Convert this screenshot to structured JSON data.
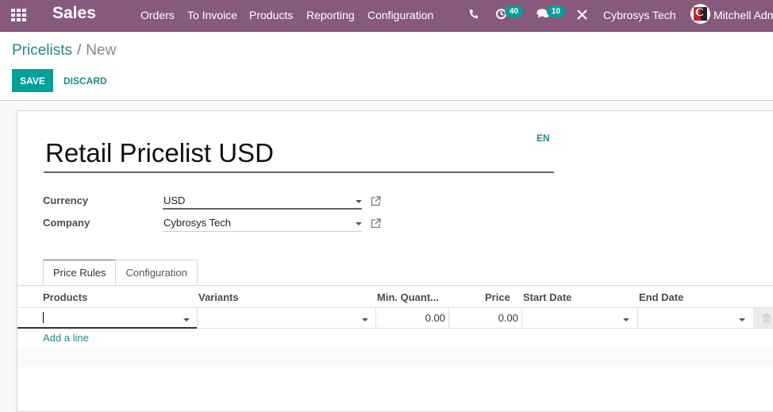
{
  "navbar": {
    "app_title": "Sales",
    "menu": [
      "Orders",
      "To Invoice",
      "Products",
      "Reporting",
      "Configuration"
    ],
    "activity_count": "40",
    "messages_count": "10",
    "company": "Cybrosys Tech",
    "user": "Mitchell Adm",
    "colors": {
      "bar": "#875a7b",
      "badge": "#00a09d"
    }
  },
  "breadcrumb": {
    "parent": "Pricelists",
    "separator": "/",
    "current": "New"
  },
  "buttons": {
    "save": "SAVE",
    "discard": "DISCARD"
  },
  "form": {
    "name": "Retail Pricelist USD",
    "lang": "EN",
    "fields": [
      {
        "label": "Currency",
        "value": "USD"
      },
      {
        "label": "Company",
        "value": "Cybrosys Tech"
      }
    ],
    "tabs": [
      "Price Rules",
      "Configuration"
    ],
    "active_tab": "Price Rules"
  },
  "rules_table": {
    "columns": [
      "Products",
      "Variants",
      "Min. Quant...",
      "Price",
      "Start Date",
      "End Date"
    ],
    "rows": [
      {
        "product": "",
        "variant": "",
        "min_quantity": "0.00",
        "price": "0.00",
        "start_date": "",
        "end_date": ""
      }
    ],
    "add_line": "Add a line"
  }
}
